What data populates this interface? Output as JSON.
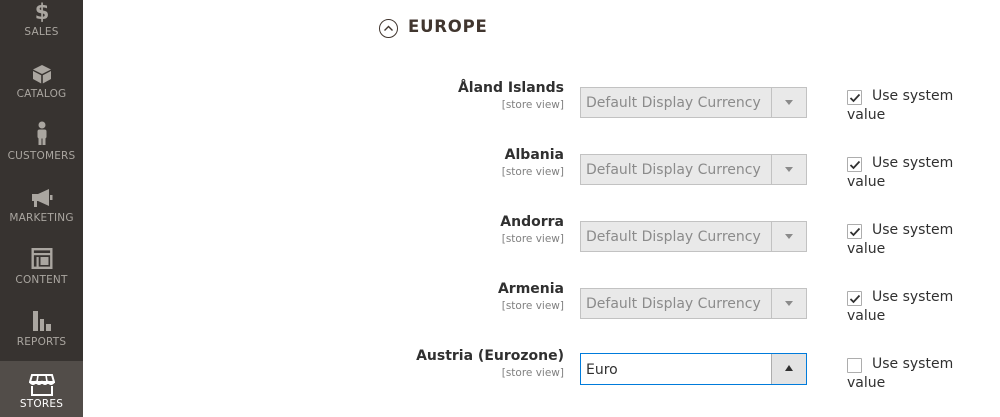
{
  "sidebar": {
    "items": [
      {
        "label": "Sales",
        "icon": "dollar-icon"
      },
      {
        "label": "Catalog",
        "icon": "box-icon"
      },
      {
        "label": "Customers",
        "icon": "person-icon"
      },
      {
        "label": "Marketing",
        "icon": "megaphone-icon"
      },
      {
        "label": "Content",
        "icon": "layout-icon"
      },
      {
        "label": "Reports",
        "icon": "bar-chart-icon"
      },
      {
        "label": "Stores",
        "icon": "storefront-icon",
        "active": true
      }
    ]
  },
  "section": {
    "title": "EUROPE",
    "toggle_icon": "chevron-up-circle-icon"
  },
  "rows": [
    {
      "label": "Åland Islands",
      "scope": "[store view]",
      "select_value": "Default Display Currency",
      "disabled": true,
      "use_system": true,
      "use_system_label": "Use system value"
    },
    {
      "label": "Albania",
      "scope": "[store view]",
      "select_value": "Default Display Currency",
      "disabled": true,
      "use_system": true,
      "use_system_label": "Use system value"
    },
    {
      "label": "Andorra",
      "scope": "[store view]",
      "select_value": "Default Display Currency",
      "disabled": true,
      "use_system": true,
      "use_system_label": "Use system value"
    },
    {
      "label": "Armenia",
      "scope": "[store view]",
      "select_value": "Default Display Currency",
      "disabled": true,
      "use_system": true,
      "use_system_label": "Use system value"
    },
    {
      "label": "Austria (Eurozone)",
      "scope": "[store view]",
      "select_value": "Euro",
      "disabled": false,
      "use_system": false,
      "use_system_label": "Use system value"
    }
  ],
  "colors": {
    "sidebar_bg": "#373330",
    "sidebar_active_bg": "#524d49",
    "focus_border": "#007bdb"
  }
}
